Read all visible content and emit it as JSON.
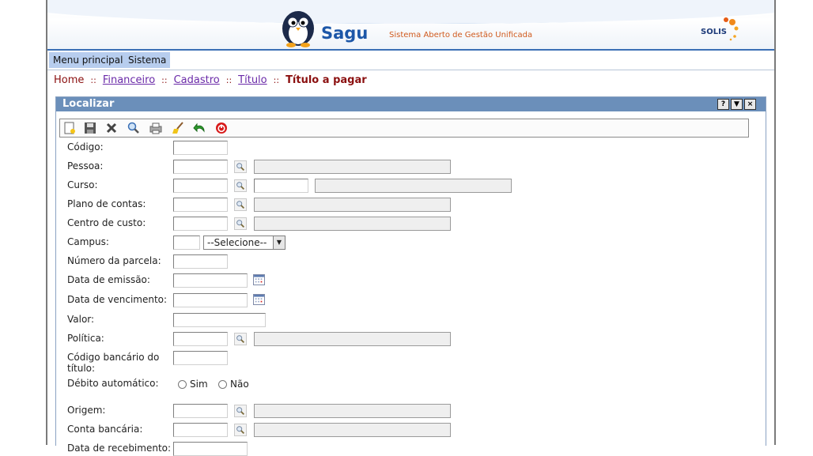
{
  "app": {
    "name": "Sagu",
    "tagline": "Sistema Aberto de Gestão Unificada",
    "vendor": "SOLIS"
  },
  "menu": [
    "Menu principal",
    "Sistema"
  ],
  "breadcrumb": {
    "home": "Home",
    "sep": "::",
    "links": [
      "Financeiro",
      "Cadastro",
      "Título"
    ],
    "current": "Título a pagar"
  },
  "panel": {
    "title": "Localizar",
    "buttons": [
      "?",
      "▼",
      "×"
    ]
  },
  "toolbar": [
    "new-icon",
    "save-icon",
    "delete-icon",
    "search-icon",
    "print-icon",
    "clear-icon",
    "back-icon",
    "exit-icon"
  ],
  "form": {
    "codigo": "Código:",
    "pessoa": "Pessoa:",
    "curso": "Curso:",
    "plano": "Plano de contas:",
    "centro": "Centro de custo:",
    "campus": "Campus:",
    "campus_select": "--Selecione--",
    "parcela": "Número da parcela:",
    "emissao": "Data de emissão:",
    "vencimento": "Data de vencimento:",
    "valor": "Valor:",
    "politica": "Política:",
    "codbanc_1": "Código bancário do",
    "codbanc_2": "título:",
    "debito": "Débito automático:",
    "sim": "Sim",
    "nao": "Não",
    "origem": "Origem:",
    "conta": "Conta bancária:",
    "cut": "Data de recebimento:"
  }
}
